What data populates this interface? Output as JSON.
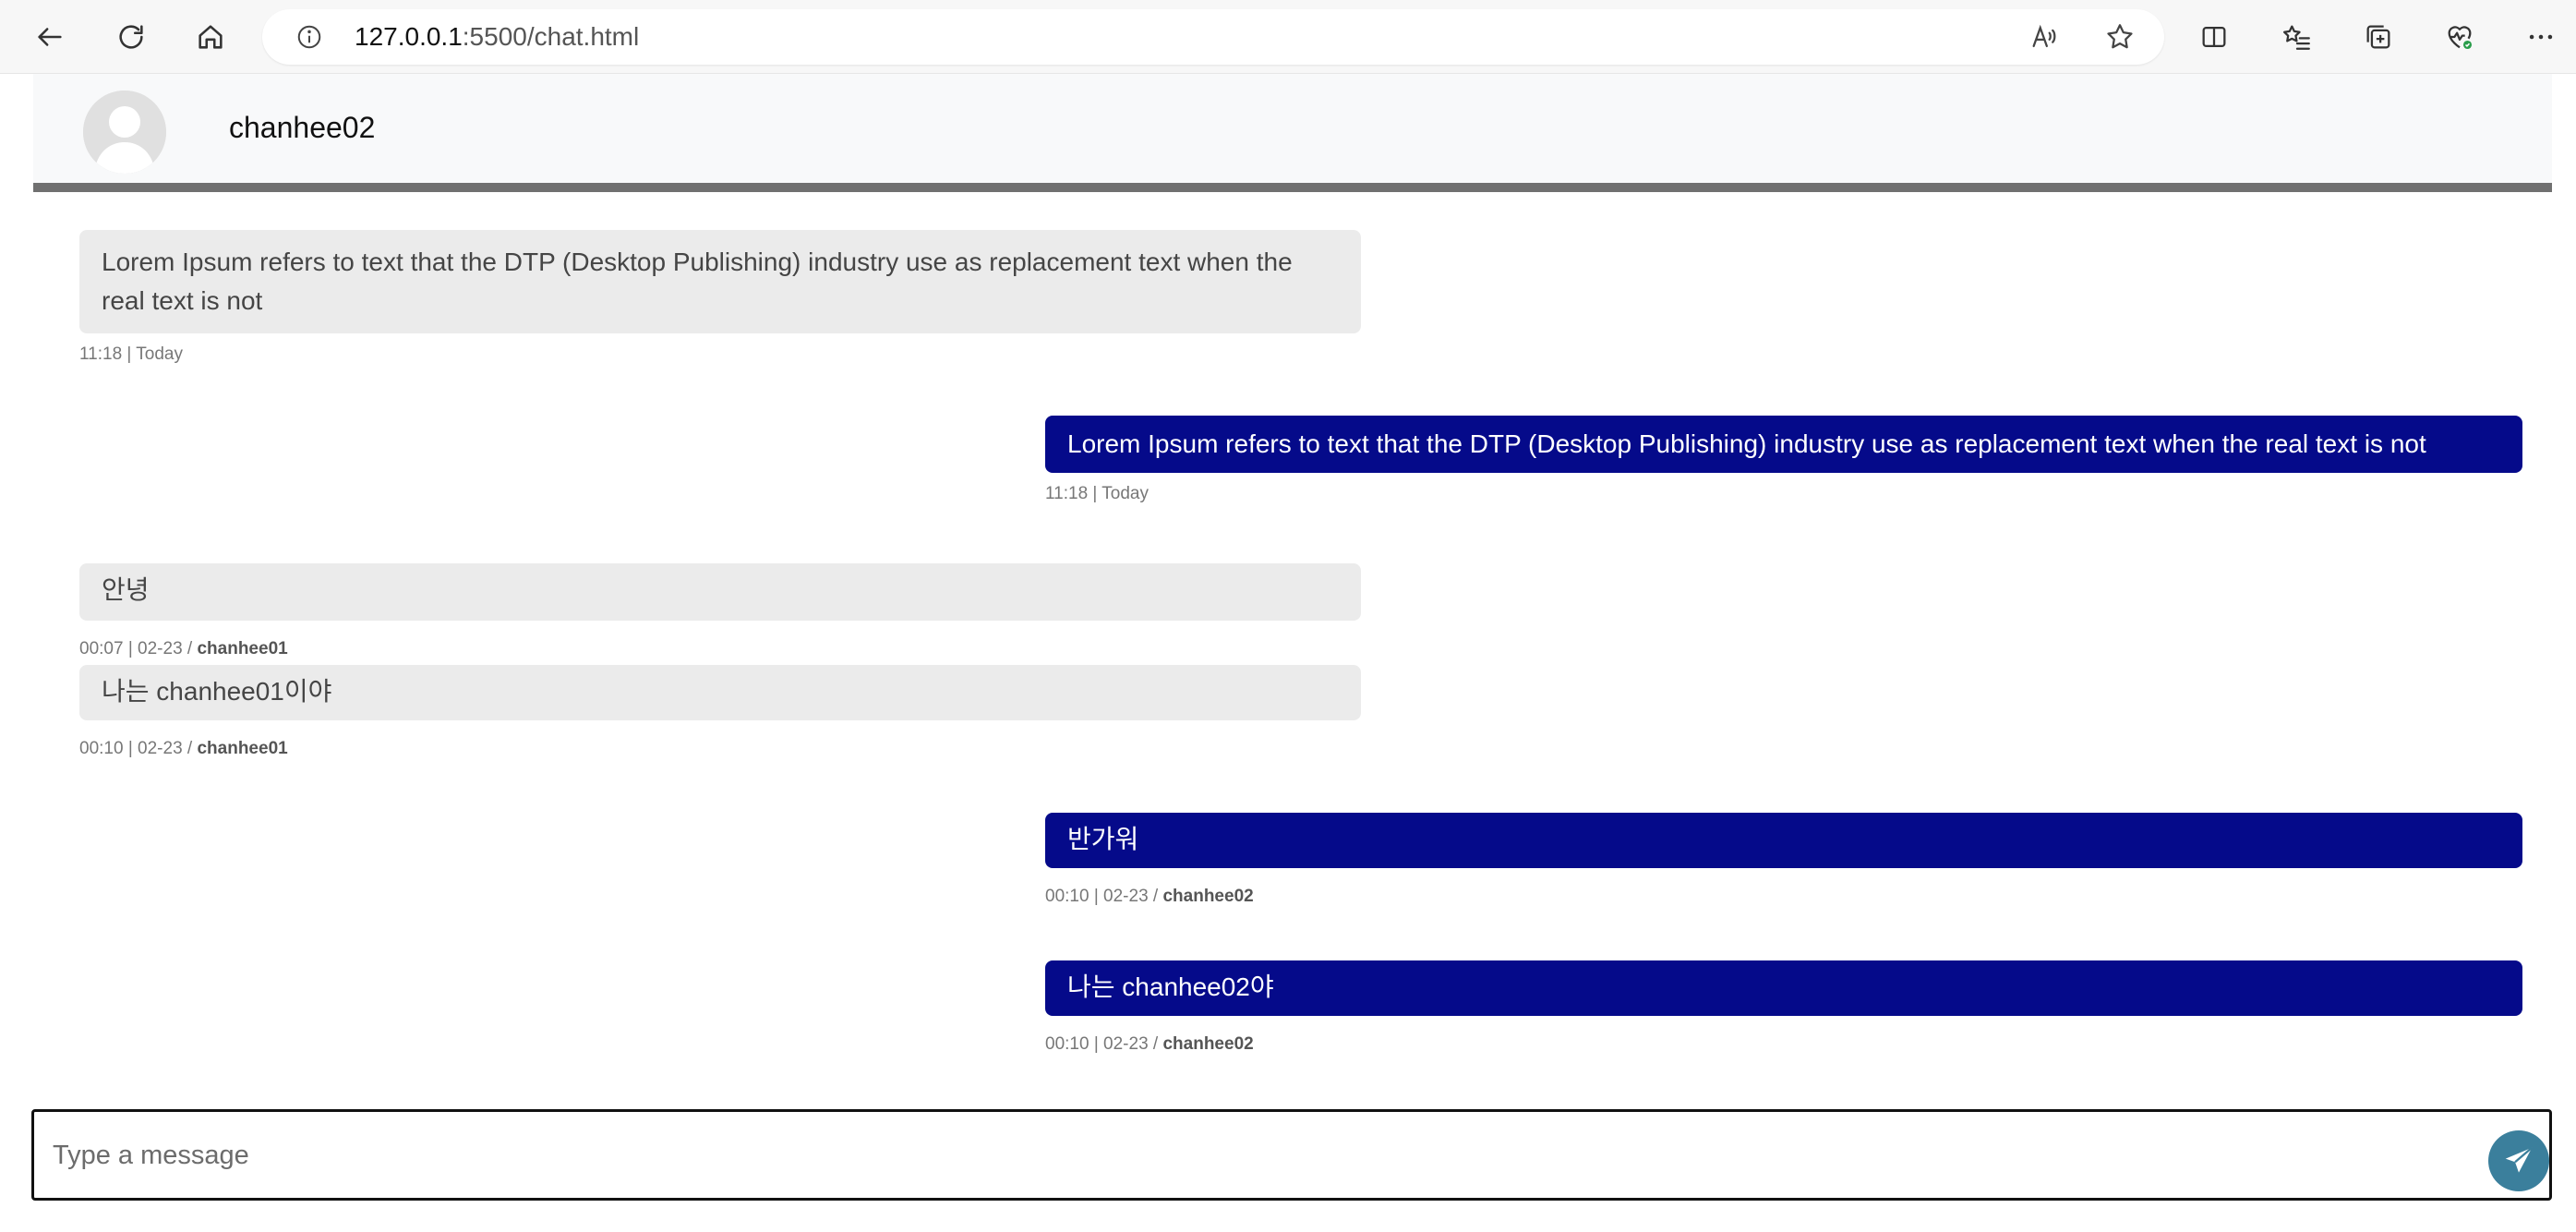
{
  "browser": {
    "url_host": "127.0.0.1",
    "url_path": ":5500/chat.html"
  },
  "chat": {
    "header_name": "chanhee02",
    "messages": [
      {
        "direction": "in",
        "text": "Lorem Ipsum refers to text that the DTP (Desktop Publishing) industry use as replacement text when the real text is not",
        "time": "11:18 | Today",
        "sender": ""
      },
      {
        "direction": "out",
        "text": "Lorem Ipsum refers to text that the DTP (Desktop Publishing) industry use as replacement text when the real text is not",
        "time": "11:18 | Today",
        "sender": ""
      },
      {
        "direction": "in",
        "text": "안녕",
        "time": "00:07 | 02-23 / ",
        "sender": "chanhee01"
      },
      {
        "direction": "in",
        "text": "나는 chanhee01이야",
        "time": "00:10 | 02-23 / ",
        "sender": "chanhee01"
      },
      {
        "direction": "out",
        "text": "반가워",
        "time": "00:10 | 02-23 / ",
        "sender": "chanhee02"
      },
      {
        "direction": "out",
        "text": "나는 chanhee02야",
        "time": "00:10 | 02-23 / ",
        "sender": "chanhee02"
      }
    ]
  },
  "composer": {
    "placeholder": "Type a message"
  },
  "colors": {
    "incoming_bubble": "#ebebeb",
    "outgoing_bubble": "#050a8a",
    "send_button": "#3b7f9c",
    "header_border": "#707070"
  }
}
